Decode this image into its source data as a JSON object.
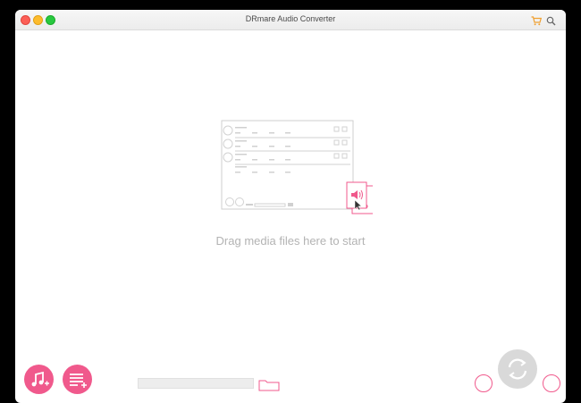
{
  "window": {
    "title": "DRmare Audio Converter",
    "accent_color": "#f0598c"
  },
  "main": {
    "drop_hint": "Drag media files here to start"
  },
  "icons": {
    "cart": "cart-icon",
    "search": "search-icon",
    "add_music": "add-music-icon",
    "add_playlist": "add-playlist-icon",
    "folder": "folder-icon",
    "convert": "convert-icon"
  }
}
